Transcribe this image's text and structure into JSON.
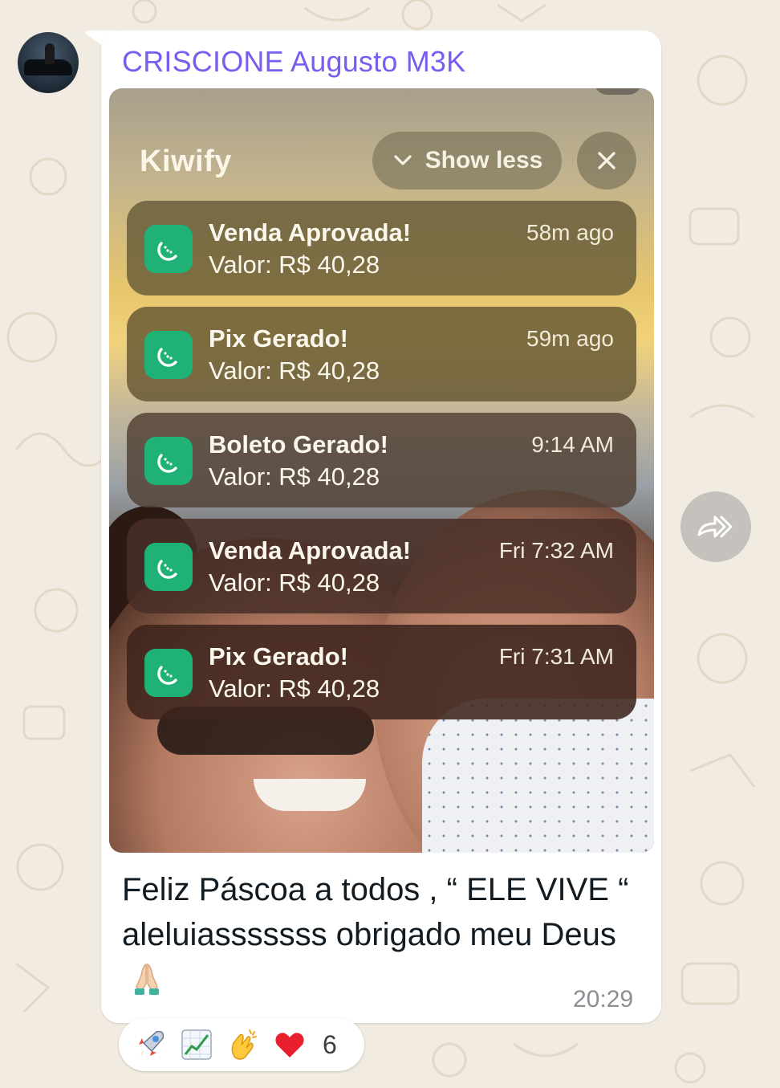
{
  "chat": {
    "sender_name": "CRISCIONE Augusto M3K",
    "caption": "Feliz Páscoa a todos , “ ELE VIVE “ aleluiasssssss obrigado meu Deus",
    "time": "20:29",
    "sender_color": "#7a5cf0"
  },
  "screenshot": {
    "app_title": "Kiwify",
    "show_less_label": "Show less",
    "notifications": [
      {
        "title": "Venda Aprovada!",
        "body": "Valor: R$ 40,28",
        "time": "58m ago"
      },
      {
        "title": "Pix Gerado!",
        "body": "Valor: R$ 40,28",
        "time": "59m ago"
      },
      {
        "title": "Boleto Gerado!",
        "body": "Valor: R$ 40,28",
        "time": "9:14 AM"
      },
      {
        "title": "Venda Aprovada!",
        "body": "Valor: R$ 40,28",
        "time": "Fri 7:32 AM"
      },
      {
        "title": "Pix Gerado!",
        "body": "Valor: R$ 40,28",
        "time": "Fri 7:31 AM"
      }
    ],
    "app_icon_color": "#1fb176"
  },
  "reactions": {
    "items": [
      "rocket-emoji",
      "chart-increasing-emoji",
      "clapping-hands-emoji",
      "red-heart-emoji"
    ],
    "count": "6"
  },
  "caption_emoji": "folded-hands-emoji",
  "icons": {
    "forward": "forward-icon",
    "close": "close-icon",
    "chevron": "chevron-down-icon"
  }
}
